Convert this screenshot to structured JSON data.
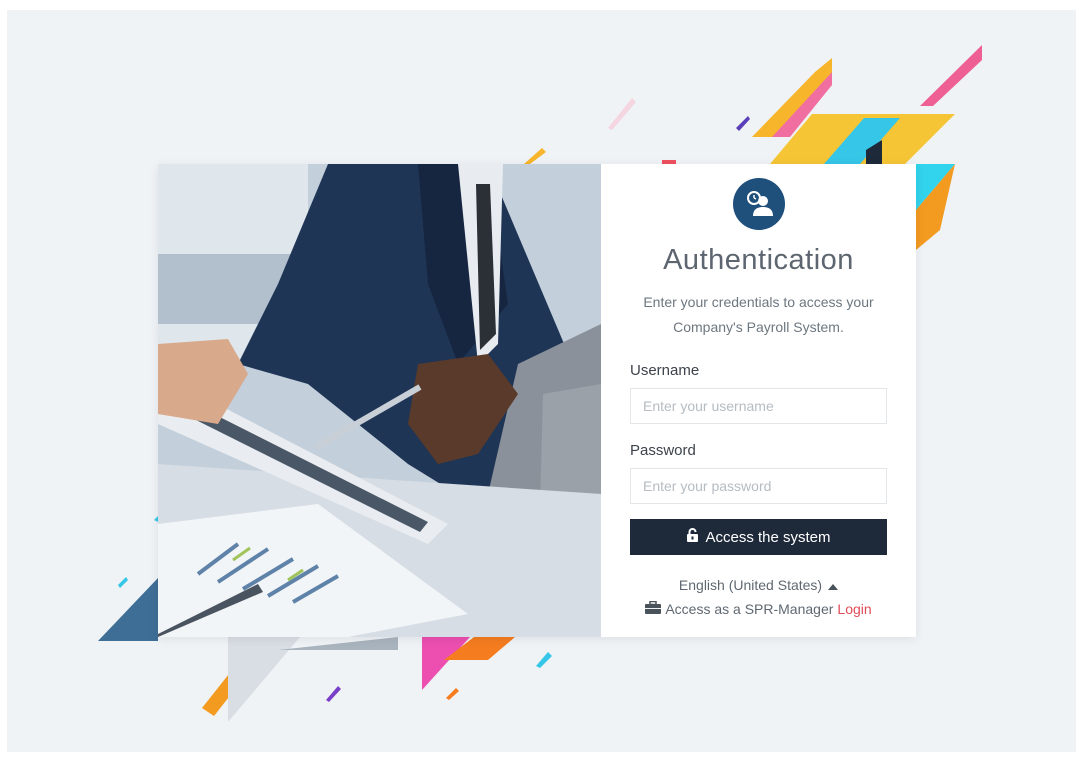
{
  "auth": {
    "title": "Authentication",
    "subtitle": "Enter your credentials to access your Company's Payroll System.",
    "username": {
      "label": "Username",
      "placeholder": "Enter your username",
      "value": ""
    },
    "password": {
      "label": "Password",
      "placeholder": "Enter your password",
      "value": ""
    },
    "submit_label": "Access the system",
    "language": "English (United States)",
    "manager_text": "Access as a SPR-Manager",
    "login_link": "Login"
  },
  "icons": {
    "logo": "clock-user-icon",
    "submit": "unlock-icon",
    "language_toggle": "caret-up-icon",
    "manager": "briefcase-icon"
  },
  "colors": {
    "logo_bg": "#1f4f7b",
    "button_bg": "#1e2a3a",
    "link": "#e04a55",
    "page_bg": "#eff3f6"
  }
}
